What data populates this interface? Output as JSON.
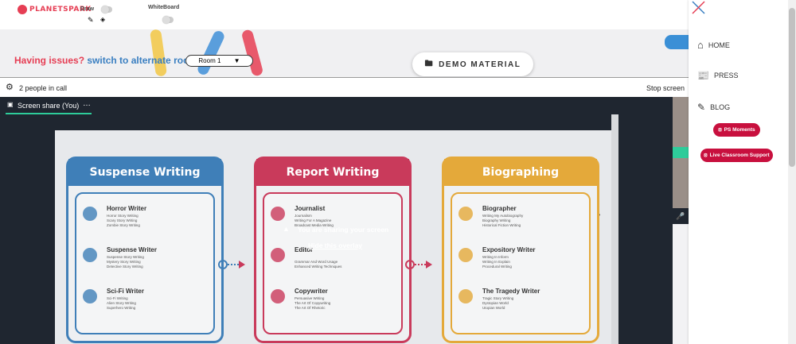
{
  "app": {
    "logo_text": "PLANETSPARK"
  },
  "toolbar": {
    "draw_label": "Draw",
    "whiteboard_label": "WhiteBoard"
  },
  "issue": {
    "prefix": "Having issues?",
    "link": "switch to alternate room",
    "room_value": "Room 1"
  },
  "demo": {
    "label": "DEMO MATERIAL"
  },
  "call": {
    "people": "2 people in call",
    "stop": "Stop screen"
  },
  "share": {
    "tab_label": "Screen share (You)",
    "more": "…"
  },
  "overlay": {
    "message": "You are sharing your screen",
    "hide": "Hide this overlay"
  },
  "slide": {
    "cards": [
      {
        "title": "Suspense Writing",
        "color": "#3f7fb8",
        "items": [
          {
            "name": "Horror Writer",
            "subs": [
              "Horror Story Writing",
              "Scary Story Writing",
              "Zombie Story Writing"
            ]
          },
          {
            "name": "Suspense Writer",
            "subs": [
              "Suspense Story Writing",
              "Mystery Story Writing",
              "Detective Story Writing"
            ]
          },
          {
            "name": "Sci-Fi Writer",
            "subs": [
              "Sci-Fi Writing",
              "Alien Story Writing",
              "Superhero Writing"
            ]
          }
        ]
      },
      {
        "title": "Report Writing",
        "color": "#c93a5b",
        "items": [
          {
            "name": "Journalist",
            "subs": [
              "Journalism",
              "Writing For A Magazine",
              "Broadcast Media Writing"
            ]
          },
          {
            "name": "Editor",
            "subs": [
              "",
              "Grammar And Word Usage",
              "Enhanced Writing Techniques"
            ]
          },
          {
            "name": "Copywriter",
            "subs": [
              "Persuasive Writing",
              "The Art Of Copywriting",
              "The Art Of Rhetoric"
            ]
          }
        ]
      },
      {
        "title": "Biographing",
        "color": "#e4a93a",
        "items": [
          {
            "name": "Biographer",
            "subs": [
              "Writing My Autobiography",
              "Biography Writing",
              "Historical Fiction Writing"
            ]
          },
          {
            "name": "Expository Writer",
            "subs": [
              "Writing In Inform",
              "Writing In Explain",
              "Procedural Writing"
            ]
          },
          {
            "name": "The Tragedy Writer",
            "subs": [
              "Tragic Story Writing",
              "Dystopian World",
              "Utopian World"
            ]
          }
        ]
      }
    ]
  },
  "sidebar": {
    "home": "HOME",
    "press": "PRESS",
    "blog": "BLOG",
    "ps_moments": "PS Moments",
    "live_support": "Live Classroom Support"
  },
  "colors": {
    "brand": "#e63e54",
    "link": "#3a7fc1",
    "pill": "#c8103e",
    "stage": "#1f2630"
  }
}
